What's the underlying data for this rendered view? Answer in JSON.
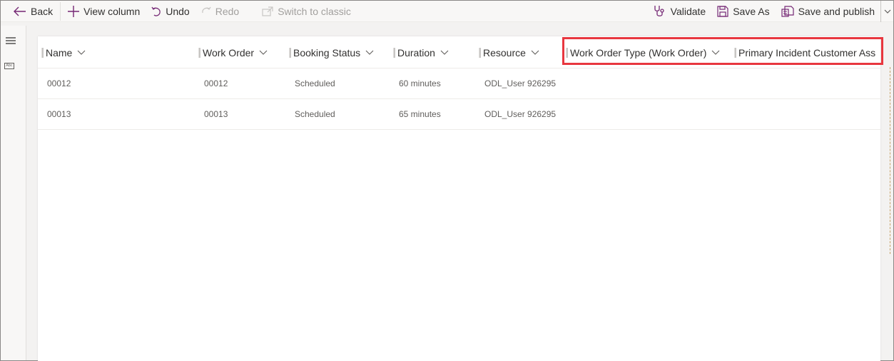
{
  "toolbar": {
    "back": "Back",
    "view_column": "View column",
    "undo": "Undo",
    "redo": "Redo",
    "switch_classic": "Switch to classic",
    "validate": "Validate",
    "save_as": "Save As",
    "save_publish": "Save and publish"
  },
  "rail": {
    "abc_label": "Abc"
  },
  "grid": {
    "columns": [
      "Name",
      "Work Order",
      "Booking Status",
      "Duration",
      "Resource",
      "Work Order Type (Work Order)",
      "Primary Incident Customer Ass"
    ],
    "rows": [
      [
        "00012",
        "00012",
        "Scheduled",
        "60 minutes",
        "ODL_User 926295"
      ],
      [
        "00013",
        "00013",
        "Scheduled",
        "65 minutes",
        "ODL_User 926295"
      ]
    ]
  },
  "colors": {
    "accent": "#742774",
    "highlight": "#e8373f"
  }
}
